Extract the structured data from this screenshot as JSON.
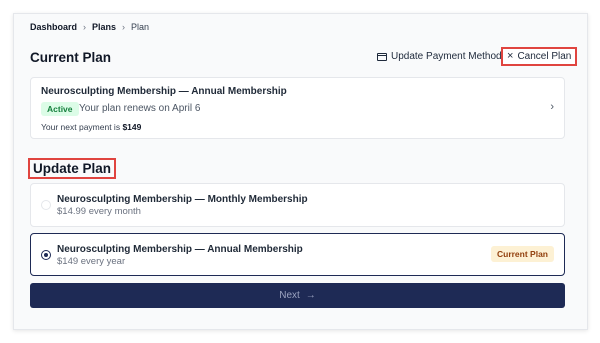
{
  "breadcrumb": [
    "Dashboard",
    "Plans",
    "Plan"
  ],
  "current_plan": {
    "title": "Current Plan",
    "update_payment_label": "Update Payment Method",
    "cancel_label": "Cancel Plan",
    "card": {
      "name": "Neurosculpting Membership — Annual Membership",
      "status": "Active",
      "renew_text": "Your plan renews on April 6",
      "next_payment_prefix": "Your next payment is",
      "next_payment_amount": "$149"
    }
  },
  "update_plan": {
    "title": "Update Plan",
    "options": [
      {
        "name": "Neurosculpting Membership — Monthly Membership",
        "price": "$14.99 every month",
        "selected": false
      },
      {
        "name": "Neurosculpting Membership — Annual Membership",
        "price": "$149 every year",
        "selected": true,
        "badge": "Current Plan"
      }
    ],
    "next_label": "Next"
  },
  "colors": {
    "accent": "#1e2a55",
    "highlight": "#e0443f",
    "active_badge_bg": "#dcfce7",
    "current_badge_bg": "#fdf1d4"
  },
  "icons": [
    "credit-card-icon",
    "close-icon",
    "chevron-right-icon",
    "arrow-right-icon"
  ]
}
